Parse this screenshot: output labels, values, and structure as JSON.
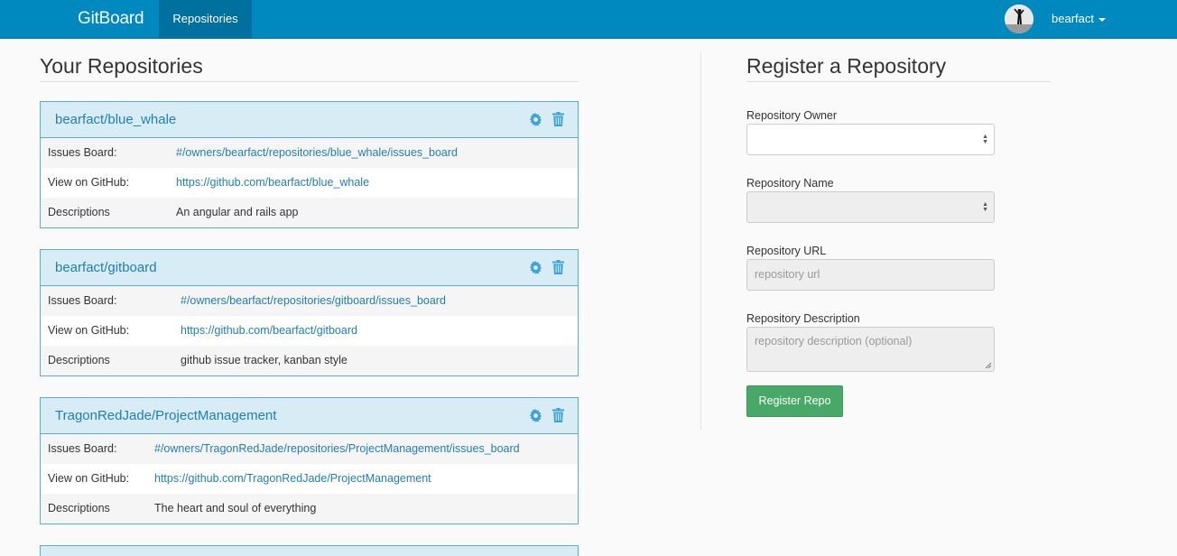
{
  "navbar": {
    "brand": "GitBoard",
    "active_tab": "Repositories",
    "username": "bearfact"
  },
  "left": {
    "heading": "Your Repositories",
    "labels": {
      "issues": "Issues Board:",
      "github": "View on GitHub:",
      "desc": "Descriptions"
    },
    "repos": [
      {
        "title": "bearfact/blue_whale",
        "issues_board": "#/owners/bearfact/repositories/blue_whale/issues_board",
        "github_url": "https://github.com/bearfact/blue_whale",
        "description": "An angular and rails app"
      },
      {
        "title": "bearfact/gitboard",
        "issues_board": "#/owners/bearfact/repositories/gitboard/issues_board",
        "github_url": "https://github.com/bearfact/gitboard",
        "description": "github issue tracker, kanban style"
      },
      {
        "title": "TragonRedJade/ProjectManagement",
        "issues_board": "#/owners/TragonRedJade/repositories/ProjectManagement/issues_board",
        "github_url": "https://github.com/TragonRedJade/ProjectManagement",
        "description": "The heart and soul of everything"
      }
    ]
  },
  "right": {
    "heading": "Register a Repository",
    "owner_label": "Repository Owner",
    "owner_value": "",
    "name_label": "Repository Name",
    "name_value": "",
    "url_label": "Repository URL",
    "url_placeholder": "repository url",
    "desc_label": "Repository Description",
    "desc_placeholder": "repository description (optional)",
    "submit_label": "Register Repo"
  },
  "colors": {
    "navbar": "#0089bf",
    "navbar_active": "#00709e",
    "panel_border": "#5aaed6",
    "panel_head": "#d8ecf6",
    "link": "#1f7eb5",
    "button": "#47a867"
  }
}
